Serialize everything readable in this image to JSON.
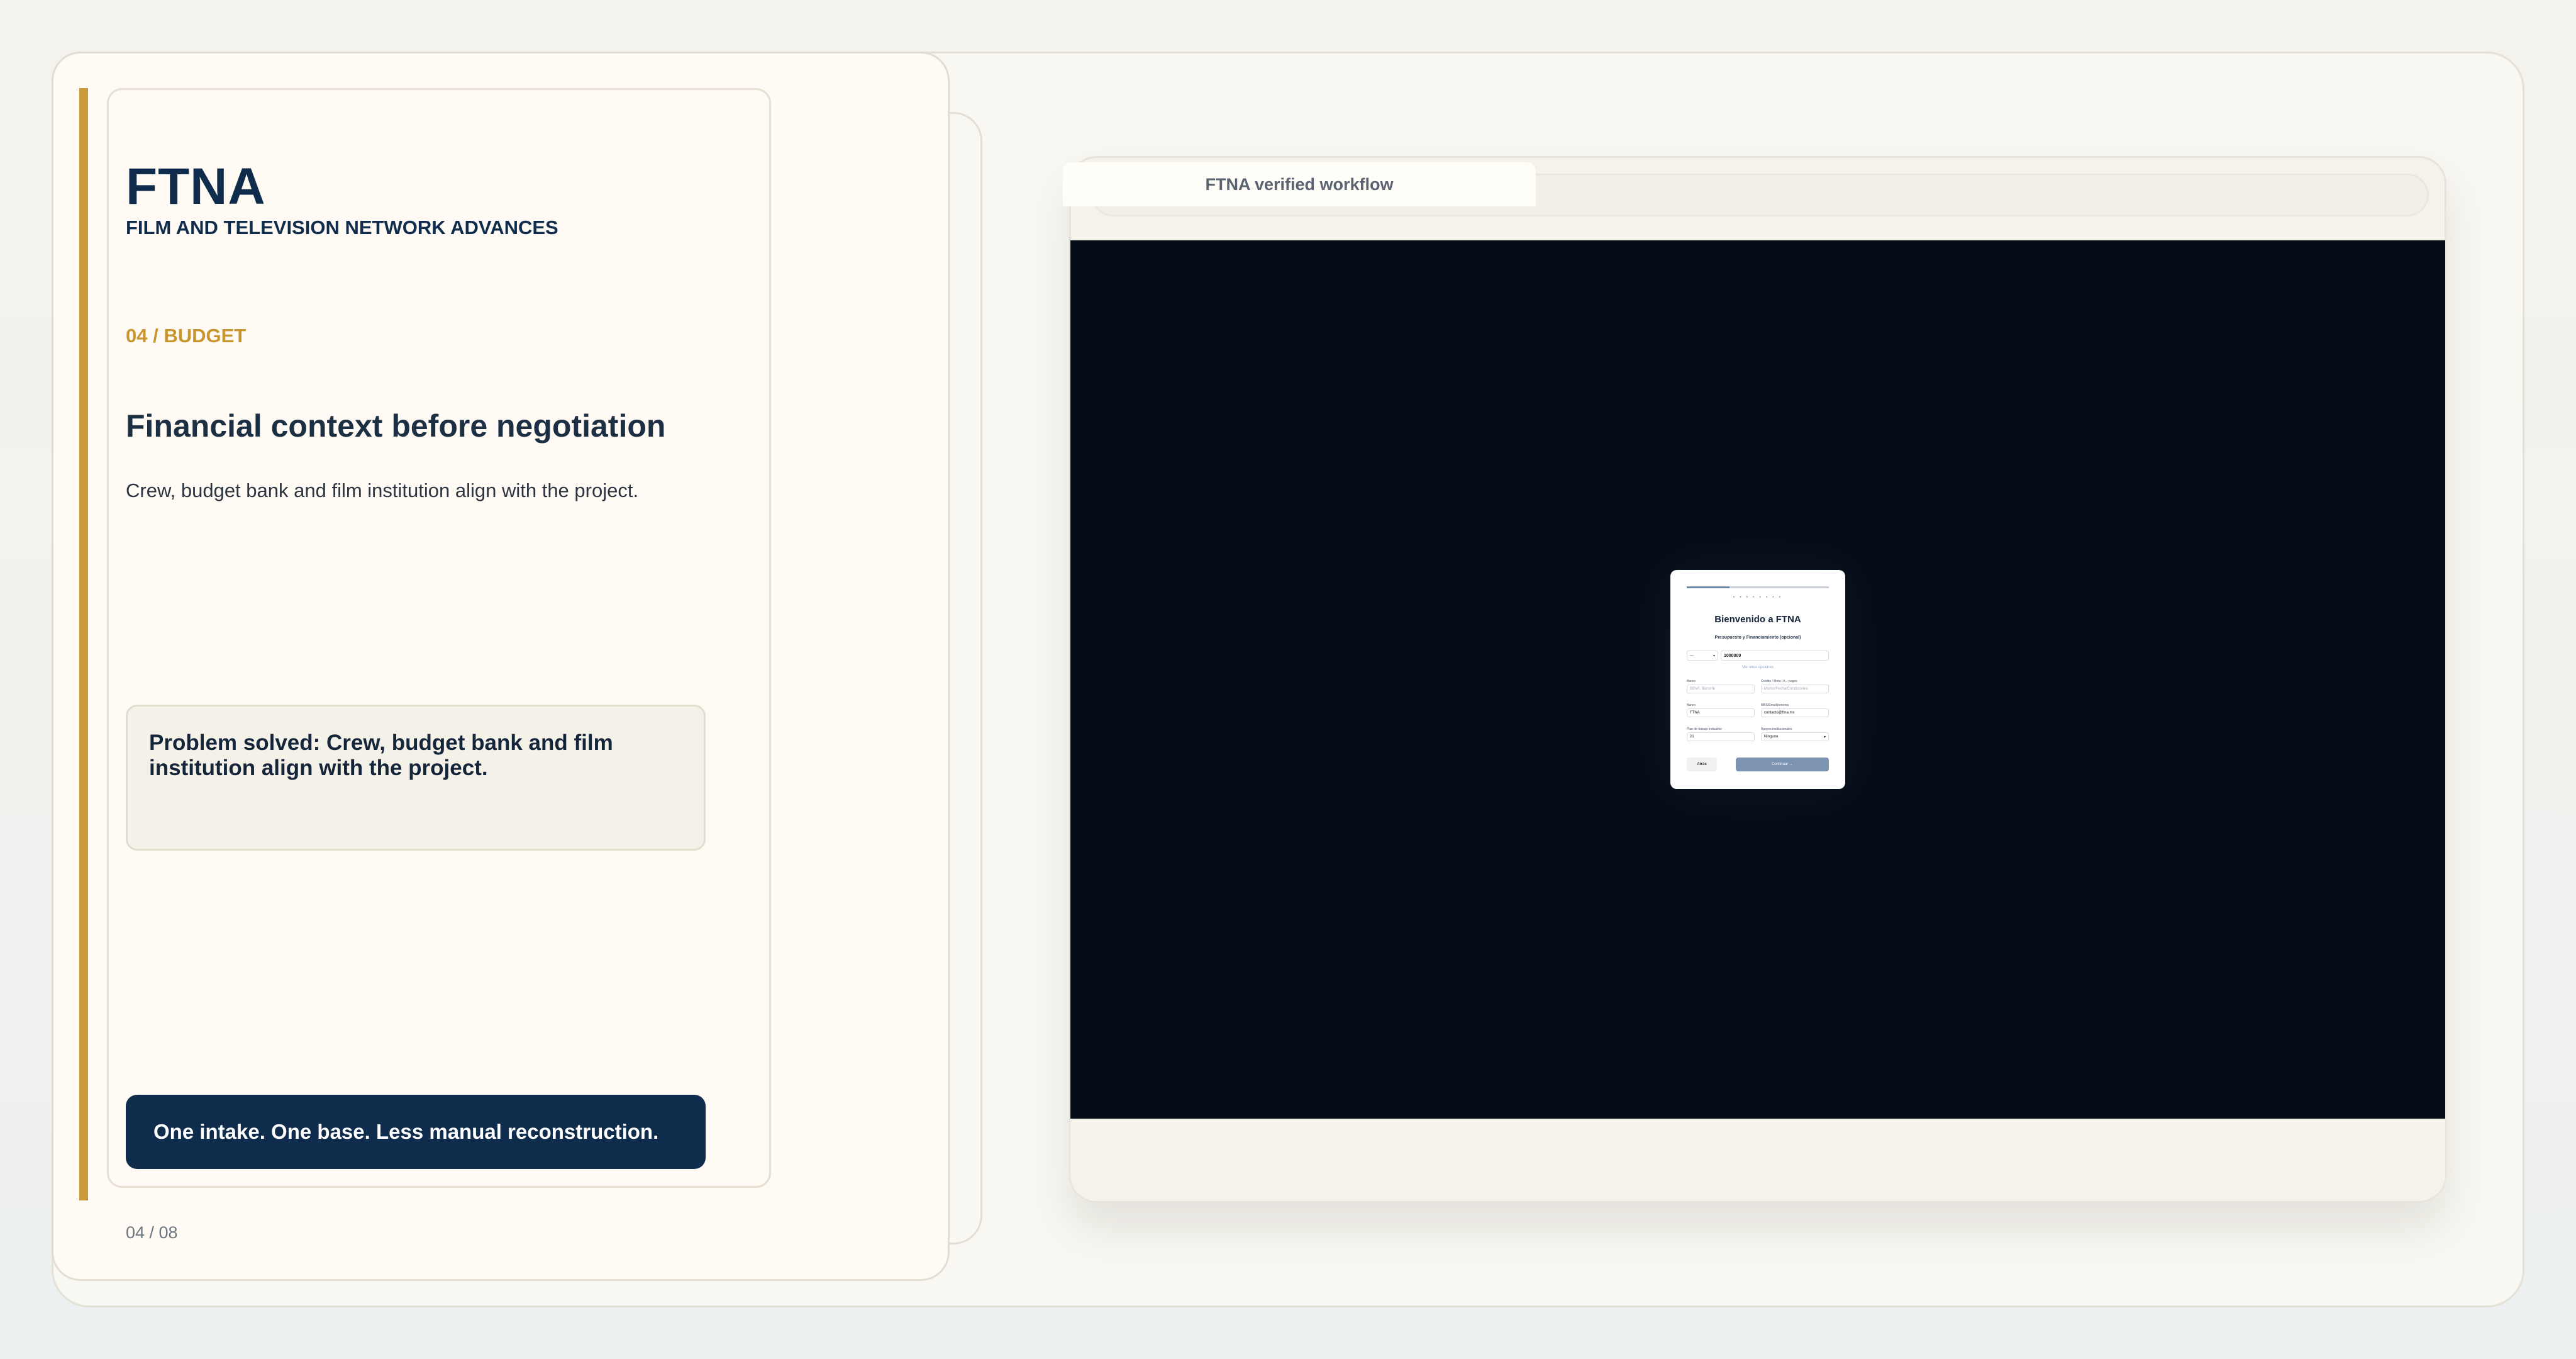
{
  "slide": {
    "brand_title": "FTNA",
    "brand_subtitle": "FILM AND TELEVISION NETWORK ADVANCES",
    "section_label": "04 / BUDGET",
    "heading": "Financial context before negotiation",
    "description": "Crew, budget bank and film institution align with the project.",
    "problem": "Problem solved: Crew, budget bank and film institution align with the project.",
    "tagline": "One intake. One base. Less manual reconstruction.",
    "page_number": "04 / 08",
    "colors": {
      "accent": "#c89a3a",
      "navy": "#0f2c4c",
      "background": "#fffaf3"
    }
  },
  "browser": {
    "tab_title": "FTNA verified workflow"
  },
  "modal": {
    "progress": 0.3,
    "step_dots": "• • • • • • • •",
    "title": "Bienvenido a FTNA",
    "subtitle": "Presupuesto y Financiamiento (opcional)",
    "country_code": "—",
    "phone_value": "1000000",
    "link_text": "Ver otras opciones",
    "fields": [
      {
        "label": "Banco",
        "value": "BBVA, Banorte",
        "placeholder": true,
        "dropdown": false
      },
      {
        "label": "Crédito / Meta / A... pagos",
        "value": "Monto/Fecha/Condiciones",
        "placeholder": true,
        "dropdown": false
      },
      {
        "label": "Banco",
        "value": "FTNA",
        "placeholder": false,
        "dropdown": false
      },
      {
        "label": "MBS/Email/persona",
        "value": "contacto@ftna.mx",
        "placeholder": false,
        "dropdown": false
      },
      {
        "label": "Plan de trabajo indicativo",
        "value": "21",
        "placeholder": false,
        "dropdown": false
      },
      {
        "label": "Apoyos institucionales",
        "value": "Ninguno",
        "placeholder": false,
        "dropdown": true
      }
    ],
    "back_label": "Atrás",
    "continue_label": "Continuar →"
  }
}
